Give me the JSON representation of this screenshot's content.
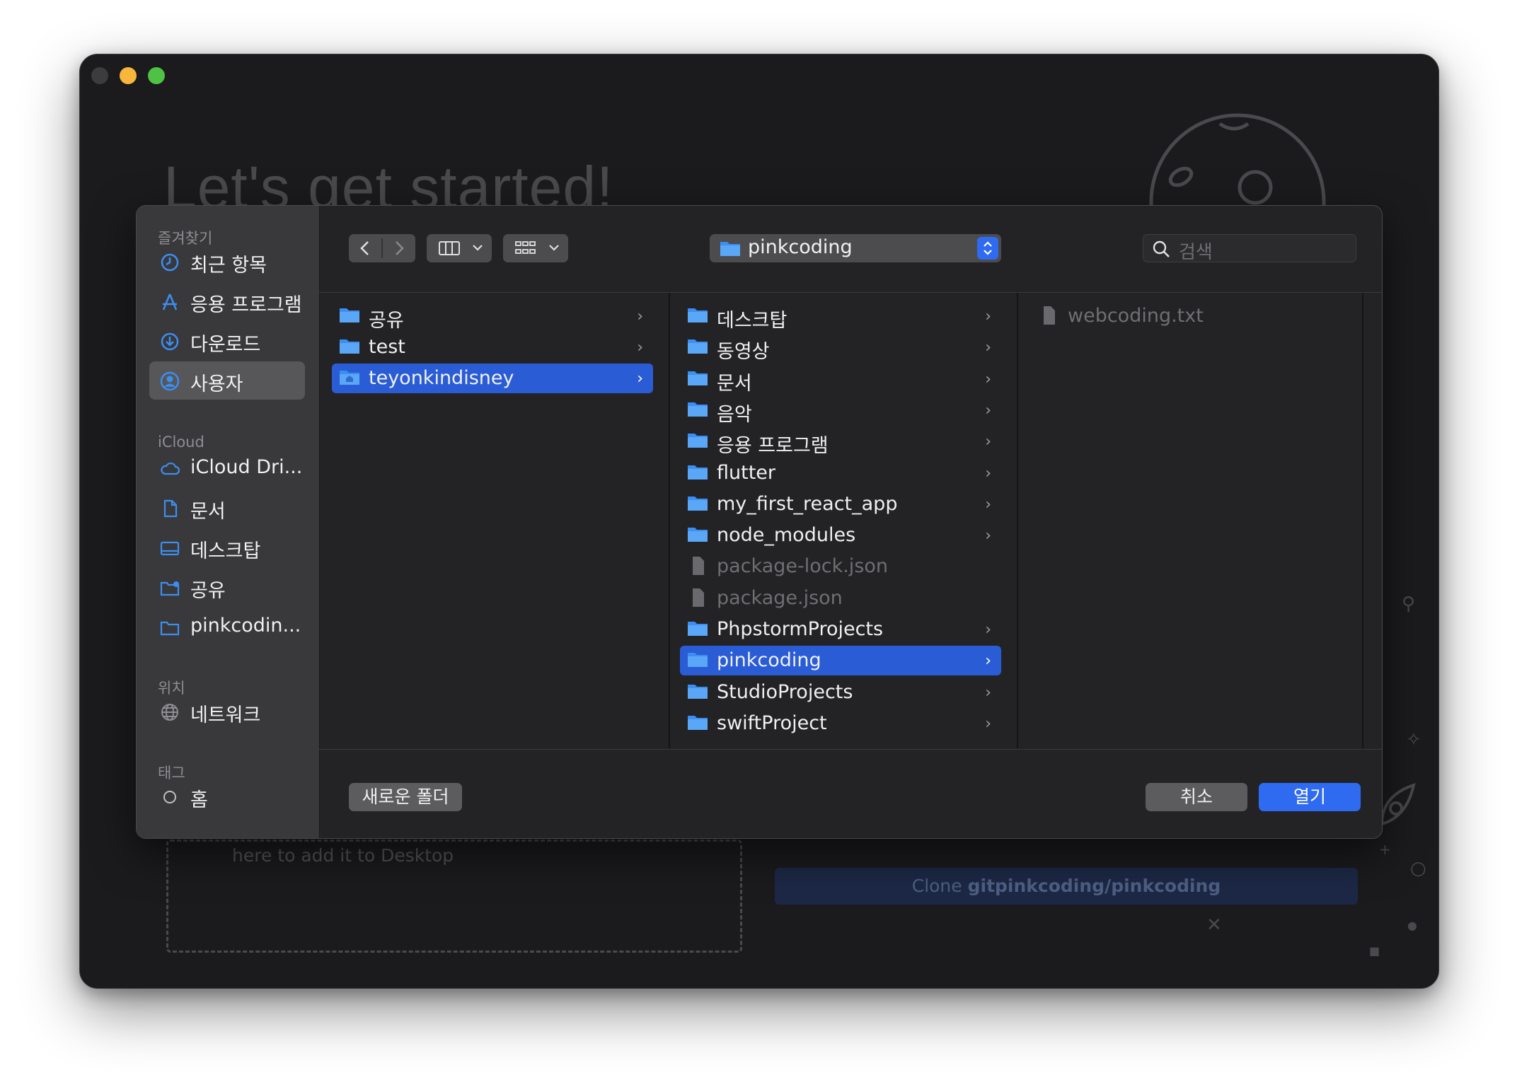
{
  "background_app": {
    "hero_title": "Let's get started!",
    "dropzone_text": "here to add it to Desktop",
    "clone_prefix": "Clone ",
    "clone_repo": "gitpinkcoding/pinkcoding"
  },
  "dialog": {
    "path_popup": {
      "label": "pinkcoding"
    },
    "search": {
      "placeholder": "검색"
    },
    "sidebar": {
      "sections": [
        {
          "title": "즐겨찾기",
          "items": [
            {
              "label": "최근 항목",
              "icon": "clock-icon"
            },
            {
              "label": "응용 프로그램",
              "icon": "applications-icon"
            },
            {
              "label": "다운로드",
              "icon": "download-icon"
            },
            {
              "label": "사용자",
              "icon": "user-icon",
              "selected": true
            }
          ]
        },
        {
          "title": "iCloud",
          "items": [
            {
              "label": "iCloud Dri...",
              "icon": "cloud-icon"
            },
            {
              "label": "문서",
              "icon": "document-icon"
            },
            {
              "label": "데스크탑",
              "icon": "desktop-icon"
            },
            {
              "label": "공유",
              "icon": "shared-folder-icon"
            },
            {
              "label": "pinkcodin...",
              "icon": "folder-icon"
            }
          ]
        },
        {
          "title": "위치",
          "items": [
            {
              "label": "네트워크",
              "icon": "globe-icon"
            }
          ]
        },
        {
          "title": "태그",
          "items": [
            {
              "label": "홈",
              "icon": "tag-circle-icon"
            }
          ]
        }
      ]
    },
    "columns": [
      {
        "rows": [
          {
            "label": "공유",
            "type": "folder",
            "chevron": true
          },
          {
            "label": "test",
            "type": "folder",
            "chevron": true
          },
          {
            "label": "teyonkindisney",
            "type": "home-folder",
            "chevron": true,
            "selected": true
          }
        ]
      },
      {
        "rows": [
          {
            "label": "데스크탑",
            "type": "folder",
            "chevron": true
          },
          {
            "label": "동영상",
            "type": "folder",
            "chevron": true
          },
          {
            "label": "문서",
            "type": "folder",
            "chevron": true
          },
          {
            "label": "음악",
            "type": "folder",
            "chevron": true
          },
          {
            "label": "응용 프로그램",
            "type": "folder",
            "chevron": true
          },
          {
            "label": "flutter",
            "type": "folder",
            "chevron": true
          },
          {
            "label": "my_first_react_app",
            "type": "folder",
            "chevron": true
          },
          {
            "label": "node_modules",
            "type": "folder",
            "chevron": true
          },
          {
            "label": "package-lock.json",
            "type": "file",
            "chevron": false
          },
          {
            "label": "package.json",
            "type": "file",
            "chevron": false
          },
          {
            "label": "PhpstormProjects",
            "type": "folder",
            "chevron": true
          },
          {
            "label": "pinkcoding",
            "type": "folder",
            "chevron": true,
            "selected": true
          },
          {
            "label": "StudioProjects",
            "type": "folder",
            "chevron": true
          },
          {
            "label": "swiftProject",
            "type": "folder",
            "chevron": true
          }
        ]
      },
      {
        "rows": [
          {
            "label": "webcoding.txt",
            "type": "file",
            "chevron": false
          }
        ]
      }
    ],
    "buttons": {
      "new_folder": "새로운 폴더",
      "cancel": "취소",
      "open": "열기"
    }
  },
  "colors": {
    "accent": "#2f6bf0",
    "selection": "#2a5cd6",
    "folder": "#3b8ef2"
  }
}
